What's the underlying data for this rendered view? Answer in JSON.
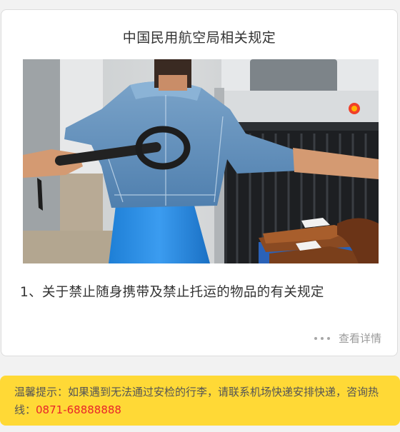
{
  "card": {
    "title": "中国民用航空局相关规定",
    "item_text": "1、关于禁止随身携带及禁止托运的物品的有关规定",
    "more_label": "查看详情",
    "photo_icon": "security-check-photo"
  },
  "notice": {
    "text_line": "温馨提示：如果遇到无法通过安检的行李，请联系机场快递安排快递，咨询热线：",
    "hotline": "0871-68888888",
    "accent_color": "#ffd936",
    "hotline_color": "#e8242a"
  }
}
